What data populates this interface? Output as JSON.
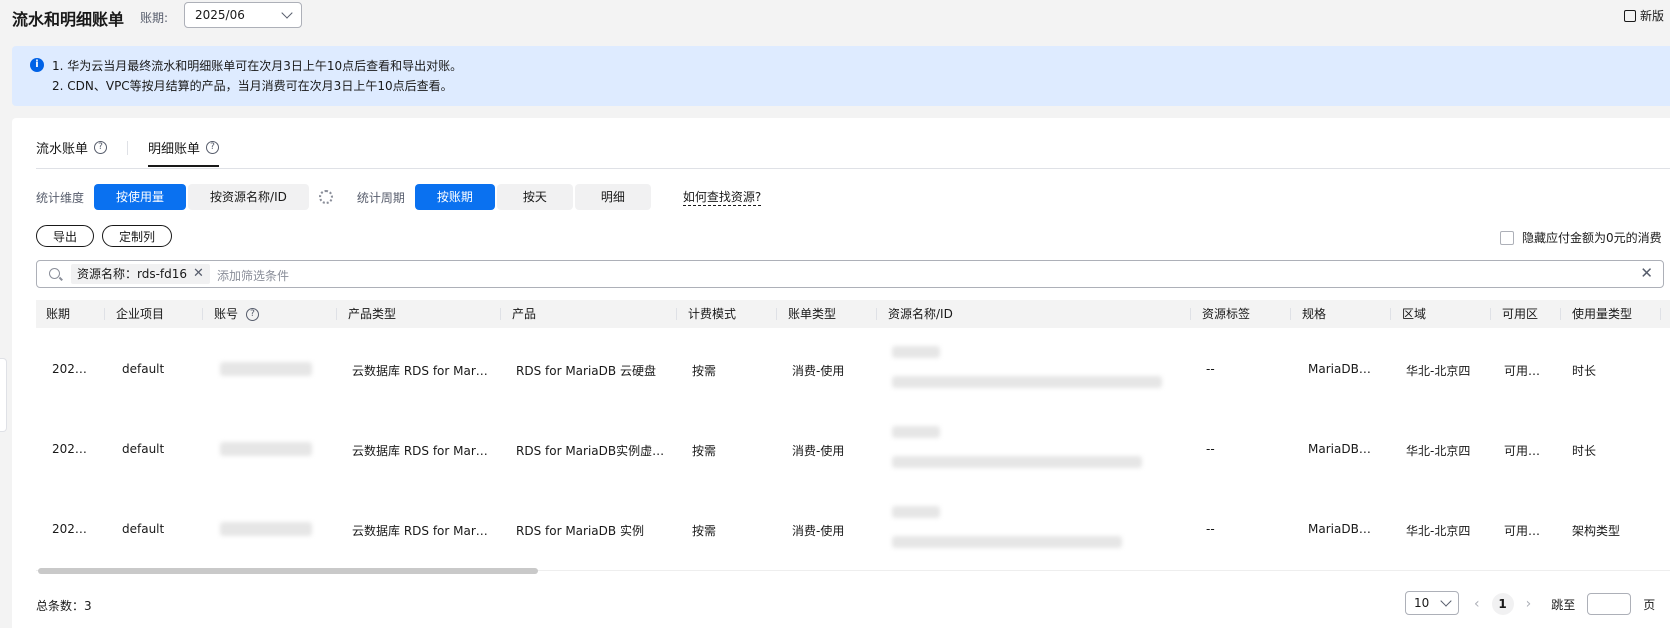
{
  "header": {
    "title": "流水和明细账单",
    "period_label": "账期:",
    "period_value": "2025/06",
    "new_version_label": "新版"
  },
  "notice": {
    "icon": "info-icon",
    "lines": [
      "1. 华为云当月最终流水和明细账单可在次月3日上午10点后查看和导出对账。",
      "2. CDN、VPC等按月结算的产品，当月消费可在次月3日上午10点后查看。"
    ]
  },
  "tabs": [
    {
      "label": "流水账单",
      "active": false
    },
    {
      "label": "明细账单",
      "active": true
    }
  ],
  "filters": {
    "dimension_label": "统计维度",
    "dimension_options": [
      "按使用量",
      "按资源名称/ID"
    ],
    "dimension_selected": "按使用量",
    "cycle_label": "统计周期",
    "cycle_options": [
      "按账期",
      "按天",
      "明细"
    ],
    "cycle_selected": "按账期",
    "find_resource_link": "如何查找资源?"
  },
  "actions": {
    "export_label": "导出",
    "custom_columns_label": "定制列",
    "hide_zero_label": "隐藏应付金额为0元的消费"
  },
  "search": {
    "tag_text": "资源名称：rds-fd16",
    "placeholder": "添加筛选条件"
  },
  "table": {
    "columns": [
      "账期",
      "企业项目",
      "账号",
      "产品类型",
      "产品",
      "计费模式",
      "账单类型",
      "资源名称/ID",
      "资源标签",
      "规格",
      "区域",
      "可用区",
      "使用量类型"
    ],
    "rows": [
      {
        "period": "202…",
        "project": "default",
        "product_type": "云数据库 RDS for Mar…",
        "product": "RDS for MariaDB 云硬盘",
        "billing_mode": "按需",
        "bill_type": "消费-使用",
        "tags": "--",
        "spec": "MariaDB|…",
        "region": "华北-北京四",
        "az": "可用…",
        "usage_type": "时长"
      },
      {
        "period": "202…",
        "project": "default",
        "product_type": "云数据库 RDS for Mar…",
        "product": "RDS for MariaDB实例虚…",
        "billing_mode": "按需",
        "bill_type": "消费-使用",
        "tags": "--",
        "spec": "MariaDB|…",
        "region": "华北-北京四",
        "az": "可用…",
        "usage_type": "时长"
      },
      {
        "period": "202…",
        "project": "default",
        "product_type": "云数据库 RDS for Mar…",
        "product": "RDS for MariaDB 实例",
        "billing_mode": "按需",
        "bill_type": "消费-使用",
        "tags": "--",
        "spec": "MariaDB|…",
        "region": "华北-北京四",
        "az": "可用…",
        "usage_type": "架构类型"
      }
    ]
  },
  "footer": {
    "total_label": "总条数：3",
    "page_size": "10",
    "current_page": "1",
    "jump_label": "跳至",
    "page_suffix": "页"
  },
  "colors": {
    "accent": "#0a71f0",
    "notice_bg": "#deebff"
  }
}
